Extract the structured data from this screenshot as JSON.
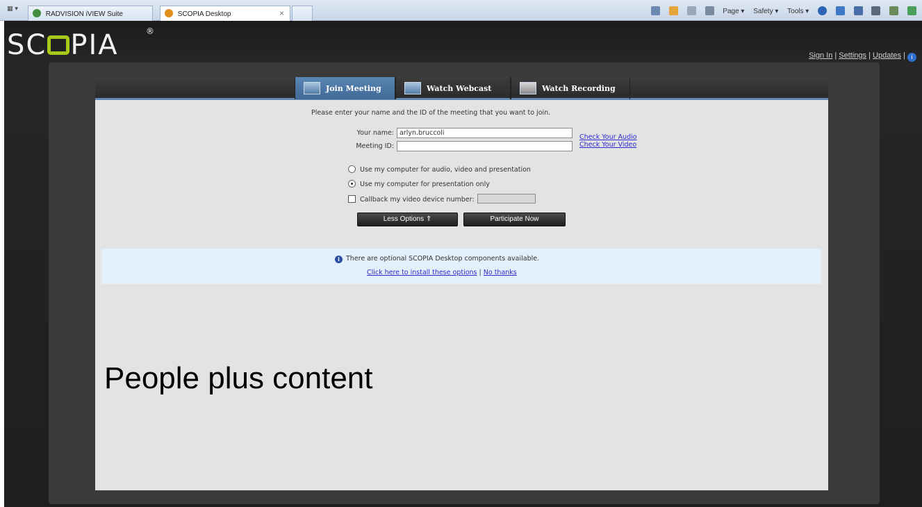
{
  "browser": {
    "tabs": [
      {
        "label": "RADVISION iVIEW Suite"
      },
      {
        "label": "SCOPIA Desktop"
      }
    ],
    "commands": {
      "page": "Page ▾",
      "safety": "Safety ▾",
      "tools": "Tools ▾"
    }
  },
  "header": {
    "logo_text_left": "SC",
    "logo_text_right": "PIA",
    "logo_reg": "®",
    "links": {
      "sign_in": "Sign In",
      "settings": "Settings",
      "updates": "Updates",
      "sep": "|"
    }
  },
  "nav_tabs": [
    {
      "label": "Join Meeting"
    },
    {
      "label": "Watch Webcast"
    },
    {
      "label": "Watch Recording"
    }
  ],
  "join_form": {
    "prompt": "Please enter your name and the ID of the meeting that you want to join.",
    "name_label": "Your name:",
    "name_value": "arlyn.bruccoli",
    "meeting_label": "Meeting ID:",
    "meeting_value": "",
    "check_audio": "Check Your Audio",
    "check_video": "Check Your Video",
    "option_full": "Use my computer for audio, video and presentation",
    "option_presentation": "Use my computer for presentation only",
    "callback_label": "Callback my video device number:",
    "less_options_button": "Less Options ⇑",
    "participate_button": "Participate Now"
  },
  "notice": {
    "text": "There are optional SCOPIA Desktop components available.",
    "install_link": "Click here to install these options",
    "separator": "|",
    "no_thanks_link": "No thanks"
  },
  "caption": "People plus content"
}
